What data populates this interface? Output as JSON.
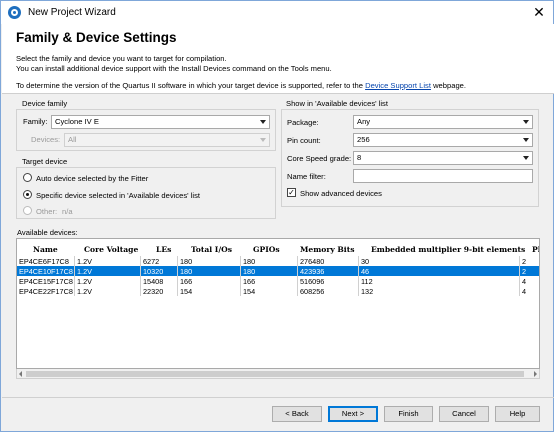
{
  "window": {
    "title": "New Project Wizard",
    "close_glyph": "✕"
  },
  "header": {
    "title": "Family & Device Settings",
    "desc_line1": "Select the family and device you want to target for compilation.",
    "desc_line2": "You can install additional device support with the Install Devices command on the Tools menu.",
    "desc_line3_pre": "To determine the version of the Quartus II software in which your target device is supported, refer to the",
    "desc_link": "Device Support List",
    "desc_line3_post": "webpage."
  },
  "device_family": {
    "group_title": "Device family",
    "family_label": "Family:",
    "family_value": "Cyclone IV E",
    "devices_label": "Devices:",
    "devices_value": "All"
  },
  "target_device": {
    "group_title": "Target device",
    "option_auto": "Auto device selected by the Fitter",
    "option_specific": "Specific device selected in 'Available devices' list",
    "option_other": "Other:",
    "other_value": "n/a",
    "selected": "specific"
  },
  "show_filter": {
    "group_title": "Show in 'Available devices' list",
    "package_label": "Package:",
    "package_value": "Any",
    "pin_count_label": "Pin count:",
    "pin_count_value": "256",
    "speed_label": "Core Speed grade:",
    "speed_value": "8",
    "name_filter_label": "Name filter:",
    "name_filter_value": "",
    "show_advanced_label": "Show advanced devices",
    "show_advanced_checked": true
  },
  "available_devices": {
    "label": "Available devices:",
    "columns": [
      "Name",
      "Core Voltage",
      "LEs",
      "Total I/Os",
      "GPIOs",
      "Memory Bits",
      "Embedded multiplier 9-bit elements",
      "Pl"
    ],
    "rows": [
      [
        "EP4CE6F17C8",
        "1.2V",
        "6272",
        "180",
        "180",
        "276480",
        "30",
        "2"
      ],
      [
        "EP4CE10F17C8",
        "1.2V",
        "10320",
        "180",
        "180",
        "423936",
        "46",
        "2"
      ],
      [
        "EP4CE15F17C8",
        "1.2V",
        "15408",
        "166",
        "166",
        "516096",
        "112",
        "4"
      ],
      [
        "EP4CE22F17C8",
        "1.2V",
        "22320",
        "154",
        "154",
        "608256",
        "132",
        "4"
      ]
    ],
    "selected_row": 1
  },
  "buttons": {
    "back": "< Back",
    "next": "Next >",
    "finish": "Finish",
    "cancel": "Cancel",
    "help": "Help"
  }
}
